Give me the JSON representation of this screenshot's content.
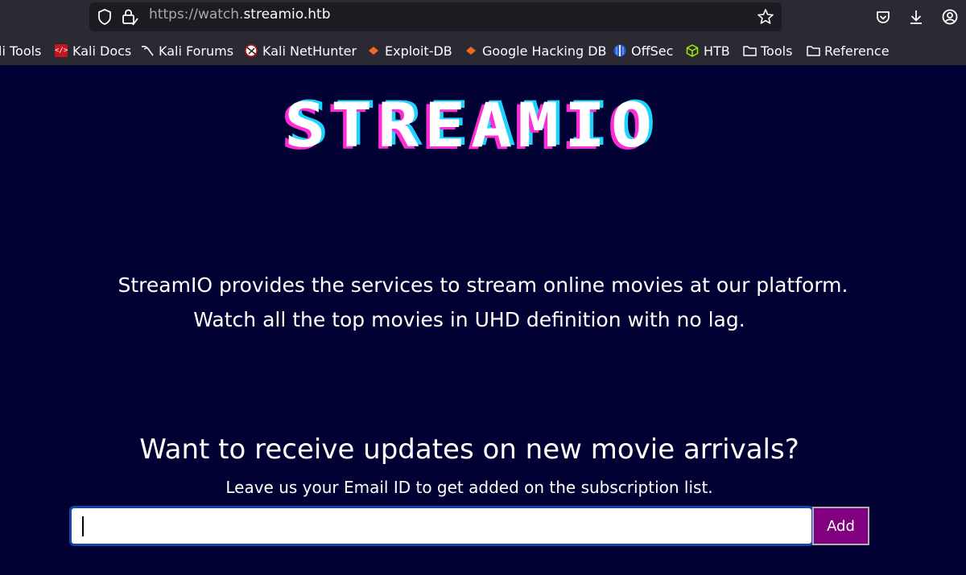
{
  "browser": {
    "url_protocol": "https://",
    "url_subdomain": "watch.",
    "url_domain": "streamio.htb",
    "icons": [
      "shield-icon",
      "lock-icon",
      "star-icon",
      "pocket-icon",
      "download-icon",
      "account-icon"
    ],
    "bookmarks": [
      {
        "label": "li Tools",
        "icon": "none"
      },
      {
        "label": "Kali Docs",
        "icon": "kali-docs-icon"
      },
      {
        "label": "Kali Forums",
        "icon": "kali-dragon-icon"
      },
      {
        "label": "Kali NetHunter",
        "icon": "nethunter-icon"
      },
      {
        "label": "Exploit-DB",
        "icon": "exploitdb-icon"
      },
      {
        "label": "Google Hacking DB",
        "icon": "ghdb-icon"
      },
      {
        "label": "OffSec",
        "icon": "offsec-icon"
      },
      {
        "label": "HTB",
        "icon": "htb-cube-icon"
      },
      {
        "label": "Tools",
        "icon": "folder-icon"
      },
      {
        "label": "Reference",
        "icon": "folder-icon"
      }
    ]
  },
  "page": {
    "logo": "STREAMIO",
    "intro_line1": "StreamIO provides the services to stream online movies at our platform.",
    "intro_line2": "Watch all the top movies in UHD definition with no lag.",
    "updates_heading": "Want to receive updates on new movie arrivals?",
    "updates_sub": "Leave us your Email ID to get added on the subscription list.",
    "email_value": "",
    "add_label": "Add"
  },
  "colors": {
    "background": "#020133",
    "button": "#800080",
    "logo_shadow_pink": "#ff2bd6",
    "logo_shadow_cyan": "#1fd3ff"
  }
}
